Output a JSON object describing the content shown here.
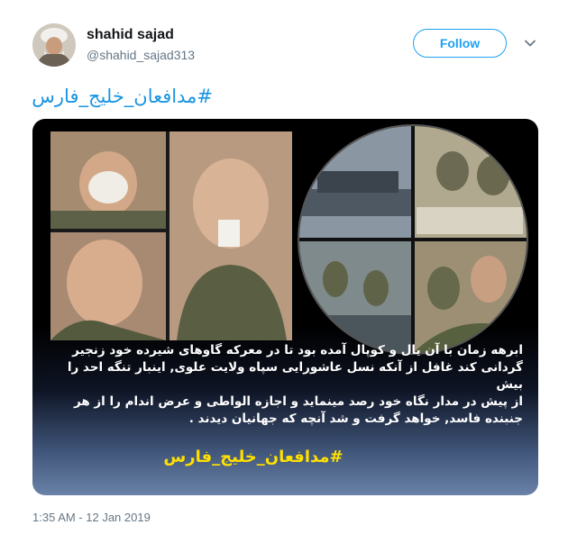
{
  "author": {
    "name": "shahid sajad",
    "handle": "@shahid_sajad313"
  },
  "actions": {
    "follow_label": "Follow",
    "menu_icon": "chevron-down-icon"
  },
  "tweet": {
    "hashtag": "#مدافعان_خلیج_فارس",
    "timestamp": "1:35 AM - 12 Jan 2019"
  },
  "media": {
    "caption_lines": [
      "ابرهه زمان با آن یال و کوپال آمده بود تا در معرکه گاوهای شیرده خود زنجیر",
      "گردانی کند غافل از آنکه نسل عاشورایی سپاه ولایت علوی, اینبار تنگه احد را بیش",
      "از پیش در مدار نگاه خود رصد مینماید و اجازه الواطی و عرض اندام را از هر",
      "جنبنده فاسد, خواهد گرفت و شد آنچه که جهانیان دیدند ."
    ],
    "hashtag": "#مدافعان_خلیج_فارس"
  },
  "colors": {
    "link_blue": "#1b95e0",
    "follow_blue": "#1da1f2",
    "media_hashtag_yellow": "#ffe000"
  }
}
